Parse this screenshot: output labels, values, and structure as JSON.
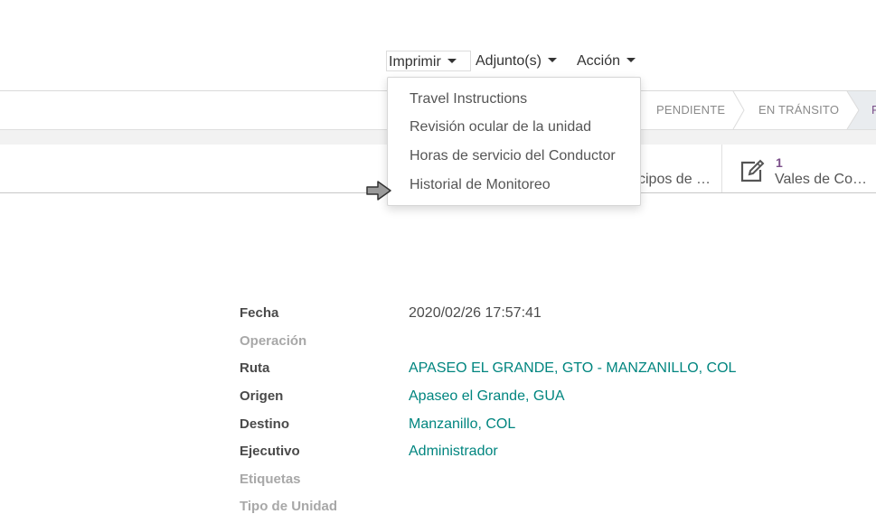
{
  "toolbar": {
    "print_label": "Imprimir",
    "attachments_label": "Adjunto(s)",
    "action_label": "Acción"
  },
  "print_menu": {
    "items": [
      "Travel Instructions",
      "Revisión ocular de la unidad",
      "Horas de servicio del Conductor",
      "Historial de Monitoreo"
    ]
  },
  "statusbar": {
    "stages": [
      "PENDIENTE",
      "EN TRÁNSITO",
      "F"
    ]
  },
  "smart_buttons": {
    "partial_label": "cipos de …",
    "vouchers": {
      "count": "1",
      "label": "Vales de Co…"
    }
  },
  "form": {
    "fields": [
      {
        "label": "Fecha",
        "value": "2020/02/26 17:57:41"
      },
      {
        "label": "Operación",
        "value": ""
      },
      {
        "label": "Ruta",
        "value": "APASEO EL GRANDE, GTO - MANZANILLO, COL"
      },
      {
        "label": "Origen",
        "value": "Apaseo el Grande, GUA"
      },
      {
        "label": "Destino",
        "value": "Manzanillo, COL"
      },
      {
        "label": "Ejecutivo",
        "value": "Administrador"
      },
      {
        "label": "Etiquetas",
        "value": ""
      },
      {
        "label": "Tipo de Unidad",
        "value": ""
      }
    ]
  },
  "colors": {
    "link": "#00857f",
    "accent_purple": "#7b4f8a",
    "muted_label": "#a8a8a8"
  }
}
